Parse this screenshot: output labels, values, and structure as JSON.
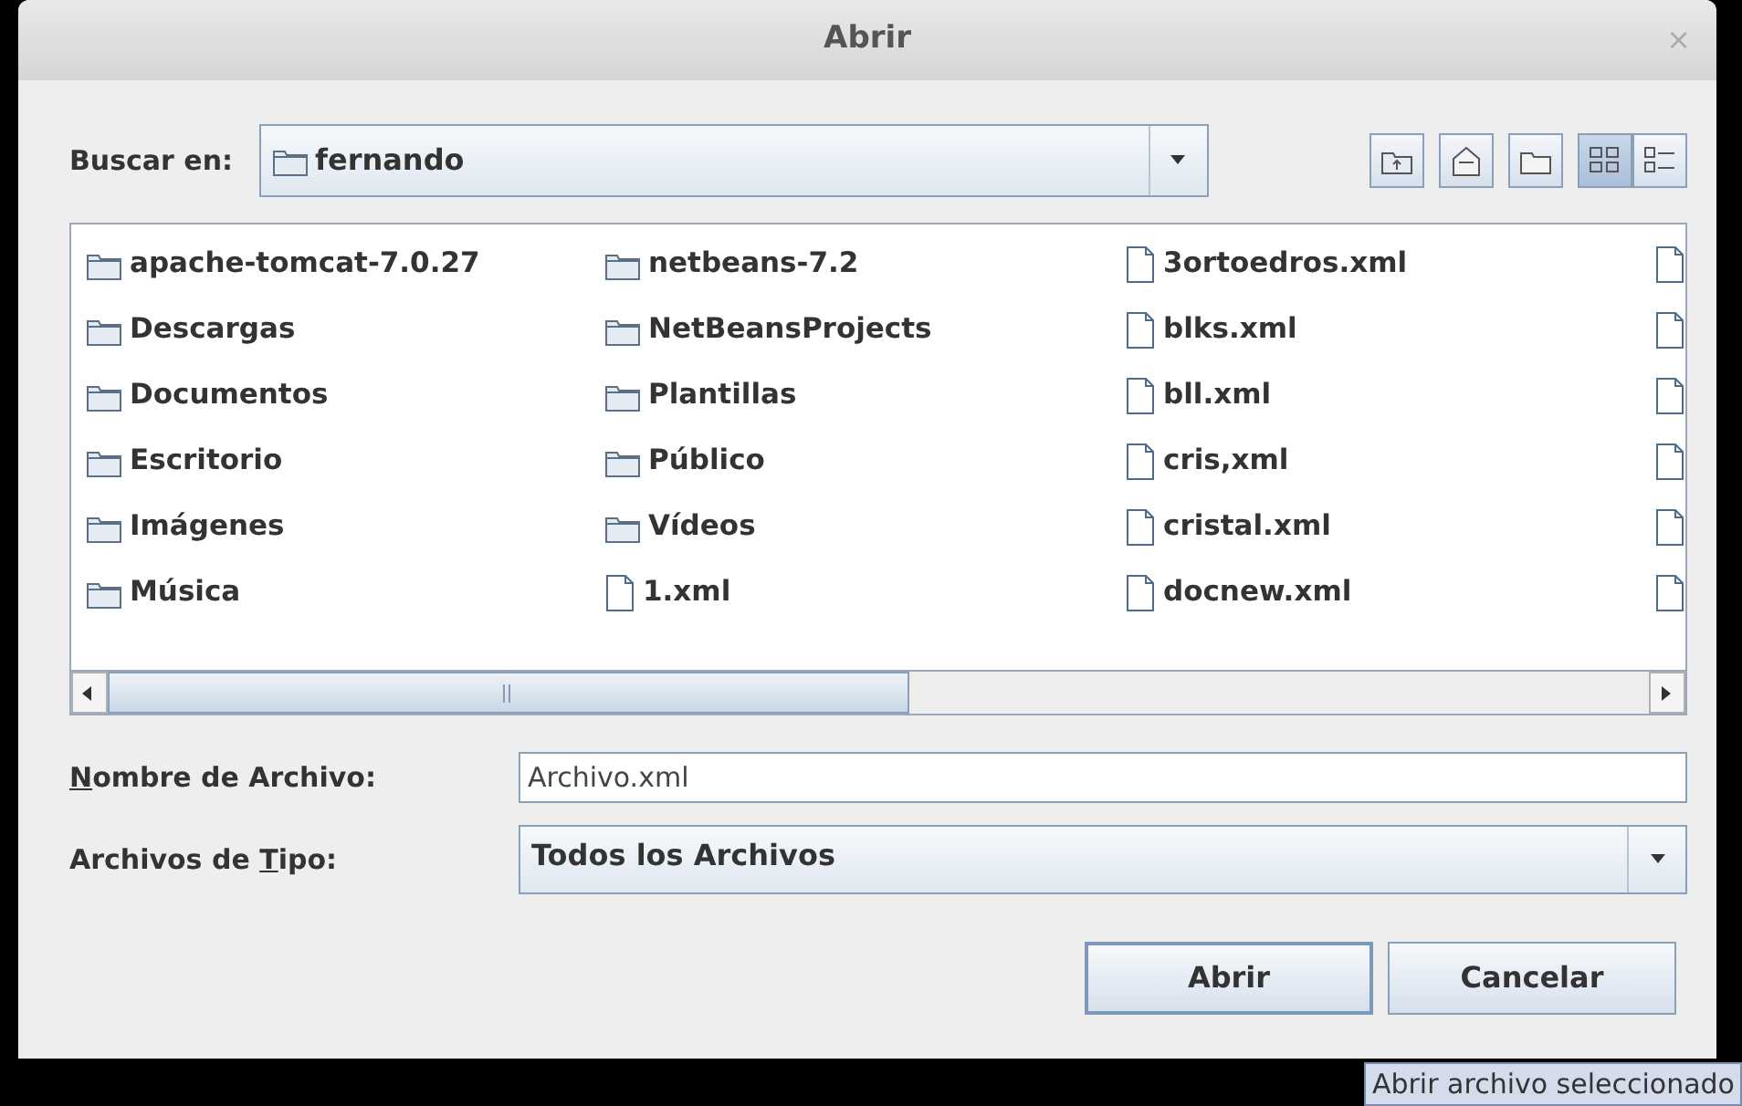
{
  "window": {
    "title": "Abrir",
    "close": "×"
  },
  "look_in": {
    "label": "Buscar en:",
    "value": "fernando"
  },
  "toolbar": [
    {
      "kind": "up",
      "selected": false
    },
    {
      "kind": "home",
      "selected": false
    },
    {
      "kind": "newfolder",
      "selected": false
    },
    {
      "kind": "list",
      "selected": true
    },
    {
      "kind": "details",
      "selected": false
    }
  ],
  "file_columns": [
    [
      {
        "kind": "folder",
        "name": "apache-tomcat-7.0.27"
      },
      {
        "kind": "folder",
        "name": "Descargas"
      },
      {
        "kind": "folder",
        "name": "Documentos"
      },
      {
        "kind": "folder",
        "name": "Escritorio"
      },
      {
        "kind": "folder",
        "name": "Imágenes"
      },
      {
        "kind": "folder",
        "name": "Música"
      }
    ],
    [
      {
        "kind": "folder",
        "name": "netbeans-7.2"
      },
      {
        "kind": "folder",
        "name": "NetBeansProjects"
      },
      {
        "kind": "folder",
        "name": "Plantillas"
      },
      {
        "kind": "folder",
        "name": "Público"
      },
      {
        "kind": "folder",
        "name": "Vídeos"
      },
      {
        "kind": "file",
        "name": "1.xml"
      }
    ],
    [
      {
        "kind": "file",
        "name": "3ortoedros.xml"
      },
      {
        "kind": "file",
        "name": "blks.xml"
      },
      {
        "kind": "file",
        "name": "bll.xml"
      },
      {
        "kind": "file",
        "name": "cris,xml"
      },
      {
        "kind": "file",
        "name": "cristal.xml"
      },
      {
        "kind": "file",
        "name": "docnew.xml"
      }
    ],
    [
      {
        "kind": "file"
      },
      {
        "kind": "file"
      },
      {
        "kind": "file"
      },
      {
        "kind": "file"
      },
      {
        "kind": "file"
      },
      {
        "kind": "file"
      }
    ]
  ],
  "file_name": {
    "label": {
      "key": "N",
      "after": "ombre de Archivo:"
    },
    "value": "Archivo.xml"
  },
  "file_type": {
    "label": {
      "before": "Archivos de ",
      "key": "T",
      "after": "ipo:"
    },
    "value": "Todos los Archivos"
  },
  "buttons": [
    {
      "label": "Abrir",
      "selected": true
    },
    {
      "label": "Cancelar",
      "selected": false
    }
  ],
  "tooltip": "Abrir archivo seleccionado"
}
